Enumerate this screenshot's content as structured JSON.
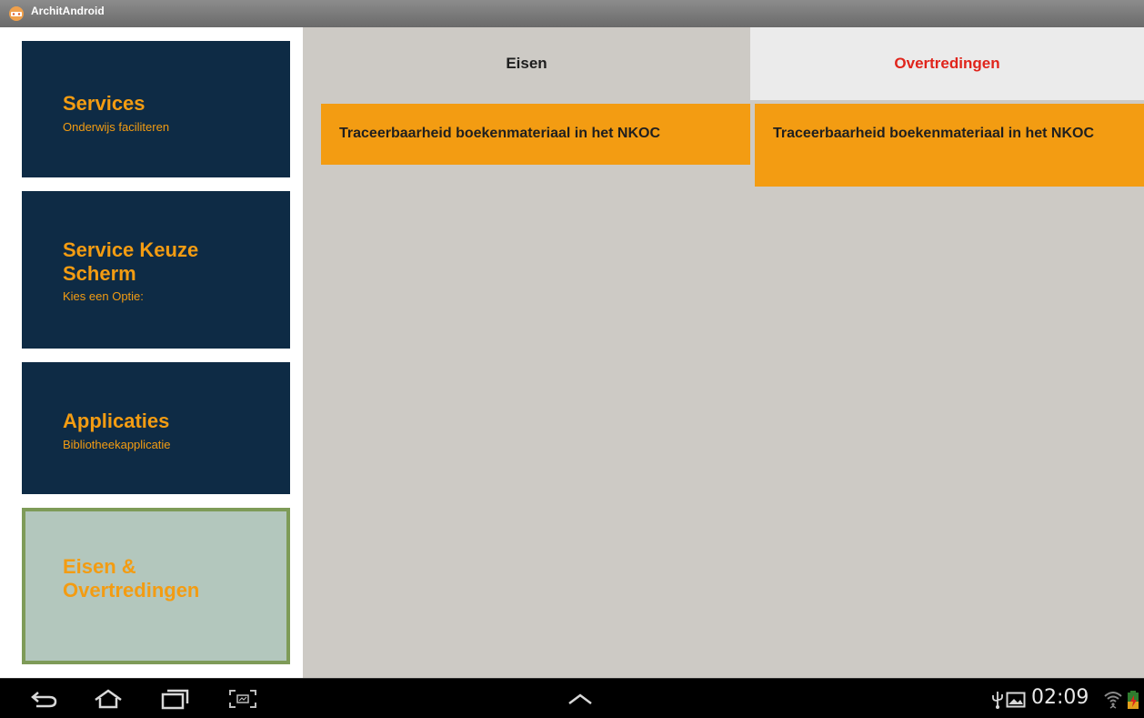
{
  "titlebar": {
    "app_title": "ArchitAndroid",
    "icon": "app-icon"
  },
  "sidebar": {
    "items": [
      {
        "title": "Services",
        "subtitle": "Onderwijs faciliteren"
      },
      {
        "title": "Service Keuze Scherm",
        "subtitle": "Kies een Optie:"
      },
      {
        "title": "Applicaties",
        "subtitle": "Bibliotheekapplicatie"
      },
      {
        "title": "Eisen & Overtredingen",
        "subtitle": ""
      }
    ],
    "active_index": 3
  },
  "tabs": [
    {
      "label": "Eisen",
      "selected": false
    },
    {
      "label": "Overtredingen",
      "selected": true
    }
  ],
  "columns": {
    "eisen": [
      {
        "text": "Traceerbaarheid boekenmateriaal in het NKOC"
      }
    ],
    "overtredingen": [
      {
        "text": "Traceerbaarheid boekenmateriaal in het NKOC"
      }
    ]
  },
  "navbar": {
    "icons": [
      "back-icon",
      "home-icon",
      "recent-apps-icon",
      "screenshot-icon",
      "menu-up-icon",
      "usb-icon",
      "gallery-icon",
      "wifi-icon",
      "battery-icon"
    ],
    "clock": "02:09"
  },
  "colors": {
    "tile_bg": "#0e2b45",
    "accent_orange": "#f39c12",
    "active_tile_bg": "#b3c7bd",
    "active_tile_border": "#7e9b58",
    "content_bg": "#cdcac5",
    "tab_selected_text": "#e0241b"
  }
}
